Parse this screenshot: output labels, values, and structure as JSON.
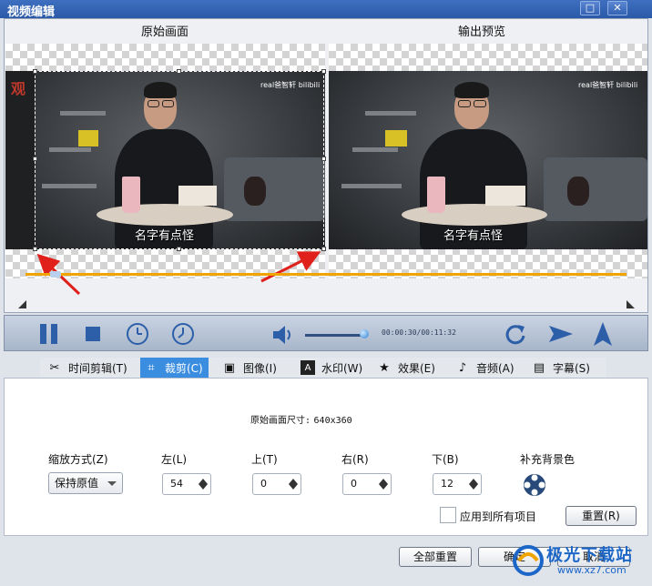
{
  "window": {
    "title": "视频编辑",
    "maximize_glyph": "□",
    "close_glyph": "✕"
  },
  "preview": {
    "original_label": "原始画面",
    "output_label": "输出预览",
    "badge_left": "观",
    "watermark_original": "real爸智轩  bilibili",
    "watermark_output": "real爸智轩  bilibili",
    "subtitle_original": "名字有点怪",
    "subtitle_output": "名字有点怪"
  },
  "player": {
    "time": "00:00:30/00:11:32",
    "volume_fraction": 0.95,
    "progress_fraction": 0.05
  },
  "tabs": [
    {
      "label": "时间剪辑(T)",
      "icon": "scissors-icon"
    },
    {
      "label": "裁剪(C)",
      "icon": "crop-icon",
      "active": true
    },
    {
      "label": "图像(I)",
      "icon": "image-icon"
    },
    {
      "label": "水印(W)",
      "icon": "watermark-icon"
    },
    {
      "label": "效果(E)",
      "icon": "star-icon"
    },
    {
      "label": "音频(A)",
      "icon": "music-note-icon"
    },
    {
      "label": "字幕(S)",
      "icon": "subtitle-icon"
    }
  ],
  "crop": {
    "source_size_label": "原始画面尺寸:",
    "source_size": "640x360",
    "scale_label": "缩放方式(Z)",
    "scale_value": "保持原值",
    "left_label": "左(L)",
    "left_value": "54",
    "top_label": "上(T)",
    "top_value": "0",
    "right_label": "右(R)",
    "right_value": "0",
    "bottom_label": "下(B)",
    "bottom_value": "12",
    "fill_bg_label": "补充背景色",
    "apply_all_label": "应用到所有项目",
    "reset_label": "重置(R)"
  },
  "footer": {
    "reset_all_label": "全部重置",
    "ok_label": "确定",
    "cancel_label": "取消"
  },
  "site": {
    "brand": "极光下载站",
    "url": "www.xz7.com"
  }
}
